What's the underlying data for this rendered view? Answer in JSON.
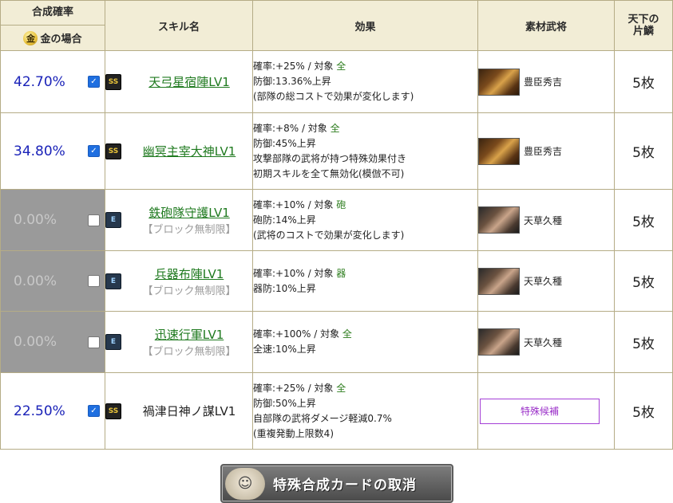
{
  "header": {
    "rate_top": "合成確率",
    "rate_bottom": "金の場合",
    "coin_glyph": "金",
    "skill_name": "スキル名",
    "effect": "効果",
    "material": "素材武将",
    "tenka_line1": "天下の",
    "tenka_line2": "片鱗"
  },
  "rows": [
    {
      "rate": "42.70%",
      "checked": true,
      "badge": "SS",
      "skill": "天弓星宿陣LV1",
      "linked": true,
      "note": "",
      "effect": [
        "確率:+25% / 対象 ",
        "全",
        "防御:13.36%上昇",
        "(部隊の総コストで効果が変化します)",
        ""
      ],
      "material": "豊臣秀吉",
      "count": "5枚"
    },
    {
      "rate": "34.80%",
      "checked": true,
      "badge": "SS",
      "skill": "幽冥主宰大神LV1",
      "linked": true,
      "note": "",
      "effect": [
        "確率:+8% / 対象 ",
        "全",
        "防御:45%上昇",
        "攻撃部隊の武将が持つ特殊効果付き",
        "初期スキルを全て無効化(模倣不可)"
      ],
      "material": "豊臣秀吉",
      "count": "5枚"
    },
    {
      "rate": "0.00%",
      "checked": false,
      "badge": "E",
      "skill": "鉄砲隊守護LV1",
      "linked": true,
      "note": "【ブロック無制限】",
      "effect": [
        "確率:+10% / 対象 ",
        "砲",
        "砲防:14%上昇",
        "(武将のコストで効果が変化します)",
        ""
      ],
      "material": "天草久種",
      "count": "5枚"
    },
    {
      "rate": "0.00%",
      "checked": false,
      "badge": "E",
      "skill": "兵器布陣LV1",
      "linked": true,
      "note": "【ブロック無制限】",
      "effect": [
        "確率:+10% / 対象 ",
        "器",
        "器防:10%上昇",
        "",
        ""
      ],
      "material": "天草久種",
      "count": "5枚"
    },
    {
      "rate": "0.00%",
      "checked": false,
      "badge": "E",
      "skill": "迅速行軍LV1",
      "linked": true,
      "note": "【ブロック無制限】",
      "effect": [
        "確率:+100% / 対象 ",
        "全",
        "全速:10%上昇",
        "",
        ""
      ],
      "material": "天草久種",
      "count": "5枚"
    },
    {
      "rate": "22.50%",
      "checked": true,
      "badge": "SS",
      "skill": "禍津日神ノ謀LV1",
      "linked": false,
      "note": "",
      "effect": [
        "確率:+25% / 対象 ",
        "全",
        "防御:50%上昇",
        "自部隊の武将ダメージ軽減0.7%",
        "(重複発動上限数4)"
      ],
      "material": "特殊候補",
      "count": "5枚"
    }
  ],
  "cancel_button": "特殊合成カードの取消",
  "colors": {
    "rate_blue": "#1a22b8",
    "link_green": "#1f7a1f",
    "header_bg": "#f2edd6",
    "disabled_bg": "#9a9a9a"
  }
}
